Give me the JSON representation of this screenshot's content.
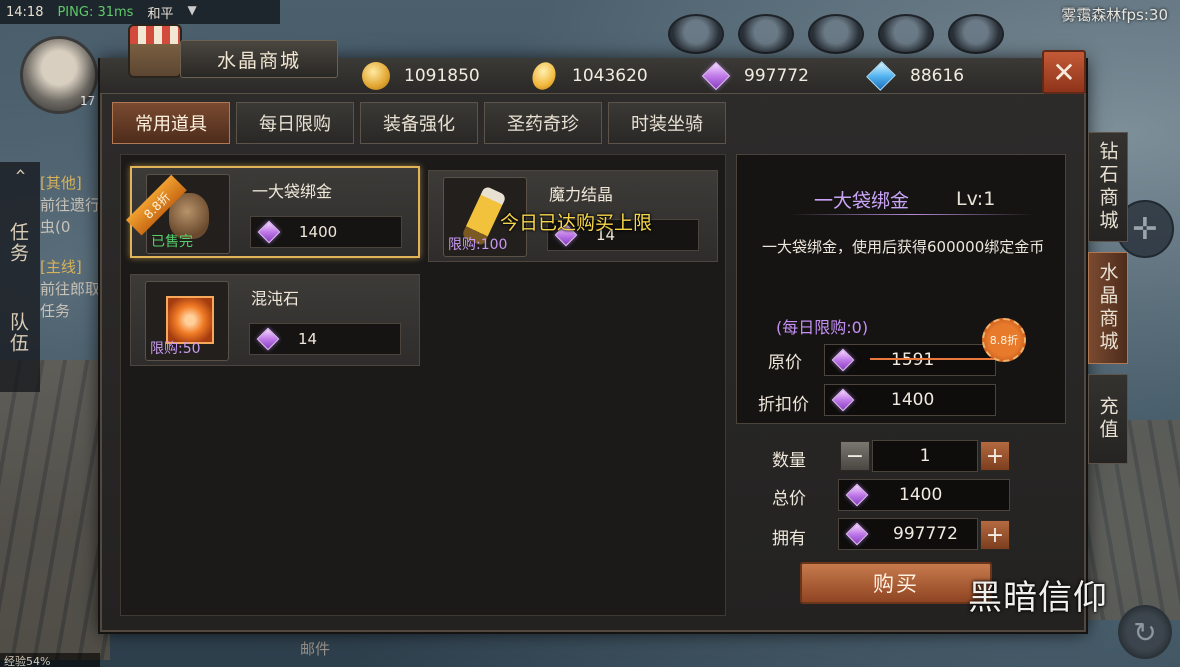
{
  "status_bar": {
    "time": "14:18",
    "ping": "PING: 31ms",
    "mode": "和平",
    "map_fps": "雾霭森林fps:30"
  },
  "player": {
    "level": "17",
    "exp": "经验54%"
  },
  "hud": {
    "tab_task": "任务",
    "tab_team": "队伍",
    "quests": [
      {
        "tag": "[其他]",
        "text": "前往遗行虫(0"
      },
      {
        "tag": "[主线]",
        "text": "前往郎取任务"
      }
    ],
    "mail": "邮件"
  },
  "shop": {
    "title": "水晶商城",
    "currencies": [
      {
        "icon": "bound-gold-icon",
        "value": "1091850"
      },
      {
        "icon": "gold-icon",
        "value": "1043620"
      },
      {
        "icon": "purple-crystal-icon",
        "value": "997772"
      },
      {
        "icon": "blue-diamond-icon",
        "value": "88616"
      }
    ],
    "close": "✕",
    "tabs": [
      {
        "label": "常用道具",
        "active": true
      },
      {
        "label": "每日限购",
        "active": false
      },
      {
        "label": "装备强化",
        "active": false
      },
      {
        "label": "圣药奇珍",
        "active": false
      },
      {
        "label": "时装坐骑",
        "active": false
      }
    ],
    "items": [
      {
        "name": "一大袋绑金",
        "price": "1400",
        "status": "已售完",
        "discount": "8.8折",
        "selected": true
      },
      {
        "name": "魔力结晶",
        "price": "14",
        "status": "限购:100",
        "selected": false
      },
      {
        "name": "混沌石",
        "price": "14",
        "status": "限购:50",
        "selected": false
      }
    ],
    "limit_warning": "今日已达购买上限",
    "side_tabs": [
      "钻石商城",
      "水晶商城",
      "充值"
    ],
    "side_tab_active": 1,
    "detail": {
      "name": "一大袋绑金",
      "level": "Lv:1",
      "description": "一大袋绑金，使用后获得600000绑定金币",
      "daily_limit": "(每日限购:0)",
      "original_label": "原价",
      "original_price": "1591",
      "discount_label": "折扣价",
      "discount_price": "1400",
      "discount_badge": "8.8折"
    },
    "purchase": {
      "qty_label": "数量",
      "qty": "1",
      "total_label": "总价",
      "total": "1400",
      "own_label": "拥有",
      "own": "997772",
      "minus": "−",
      "plus": "+",
      "buy": "购买"
    },
    "logo": "黑暗信仰"
  },
  "colors": {
    "accent": "#7a4a30",
    "selected_border": "#e2b45a",
    "crystal": "#c07ae8",
    "sold_green": "#56d06c",
    "warning_yellow": "#f6d64a"
  }
}
